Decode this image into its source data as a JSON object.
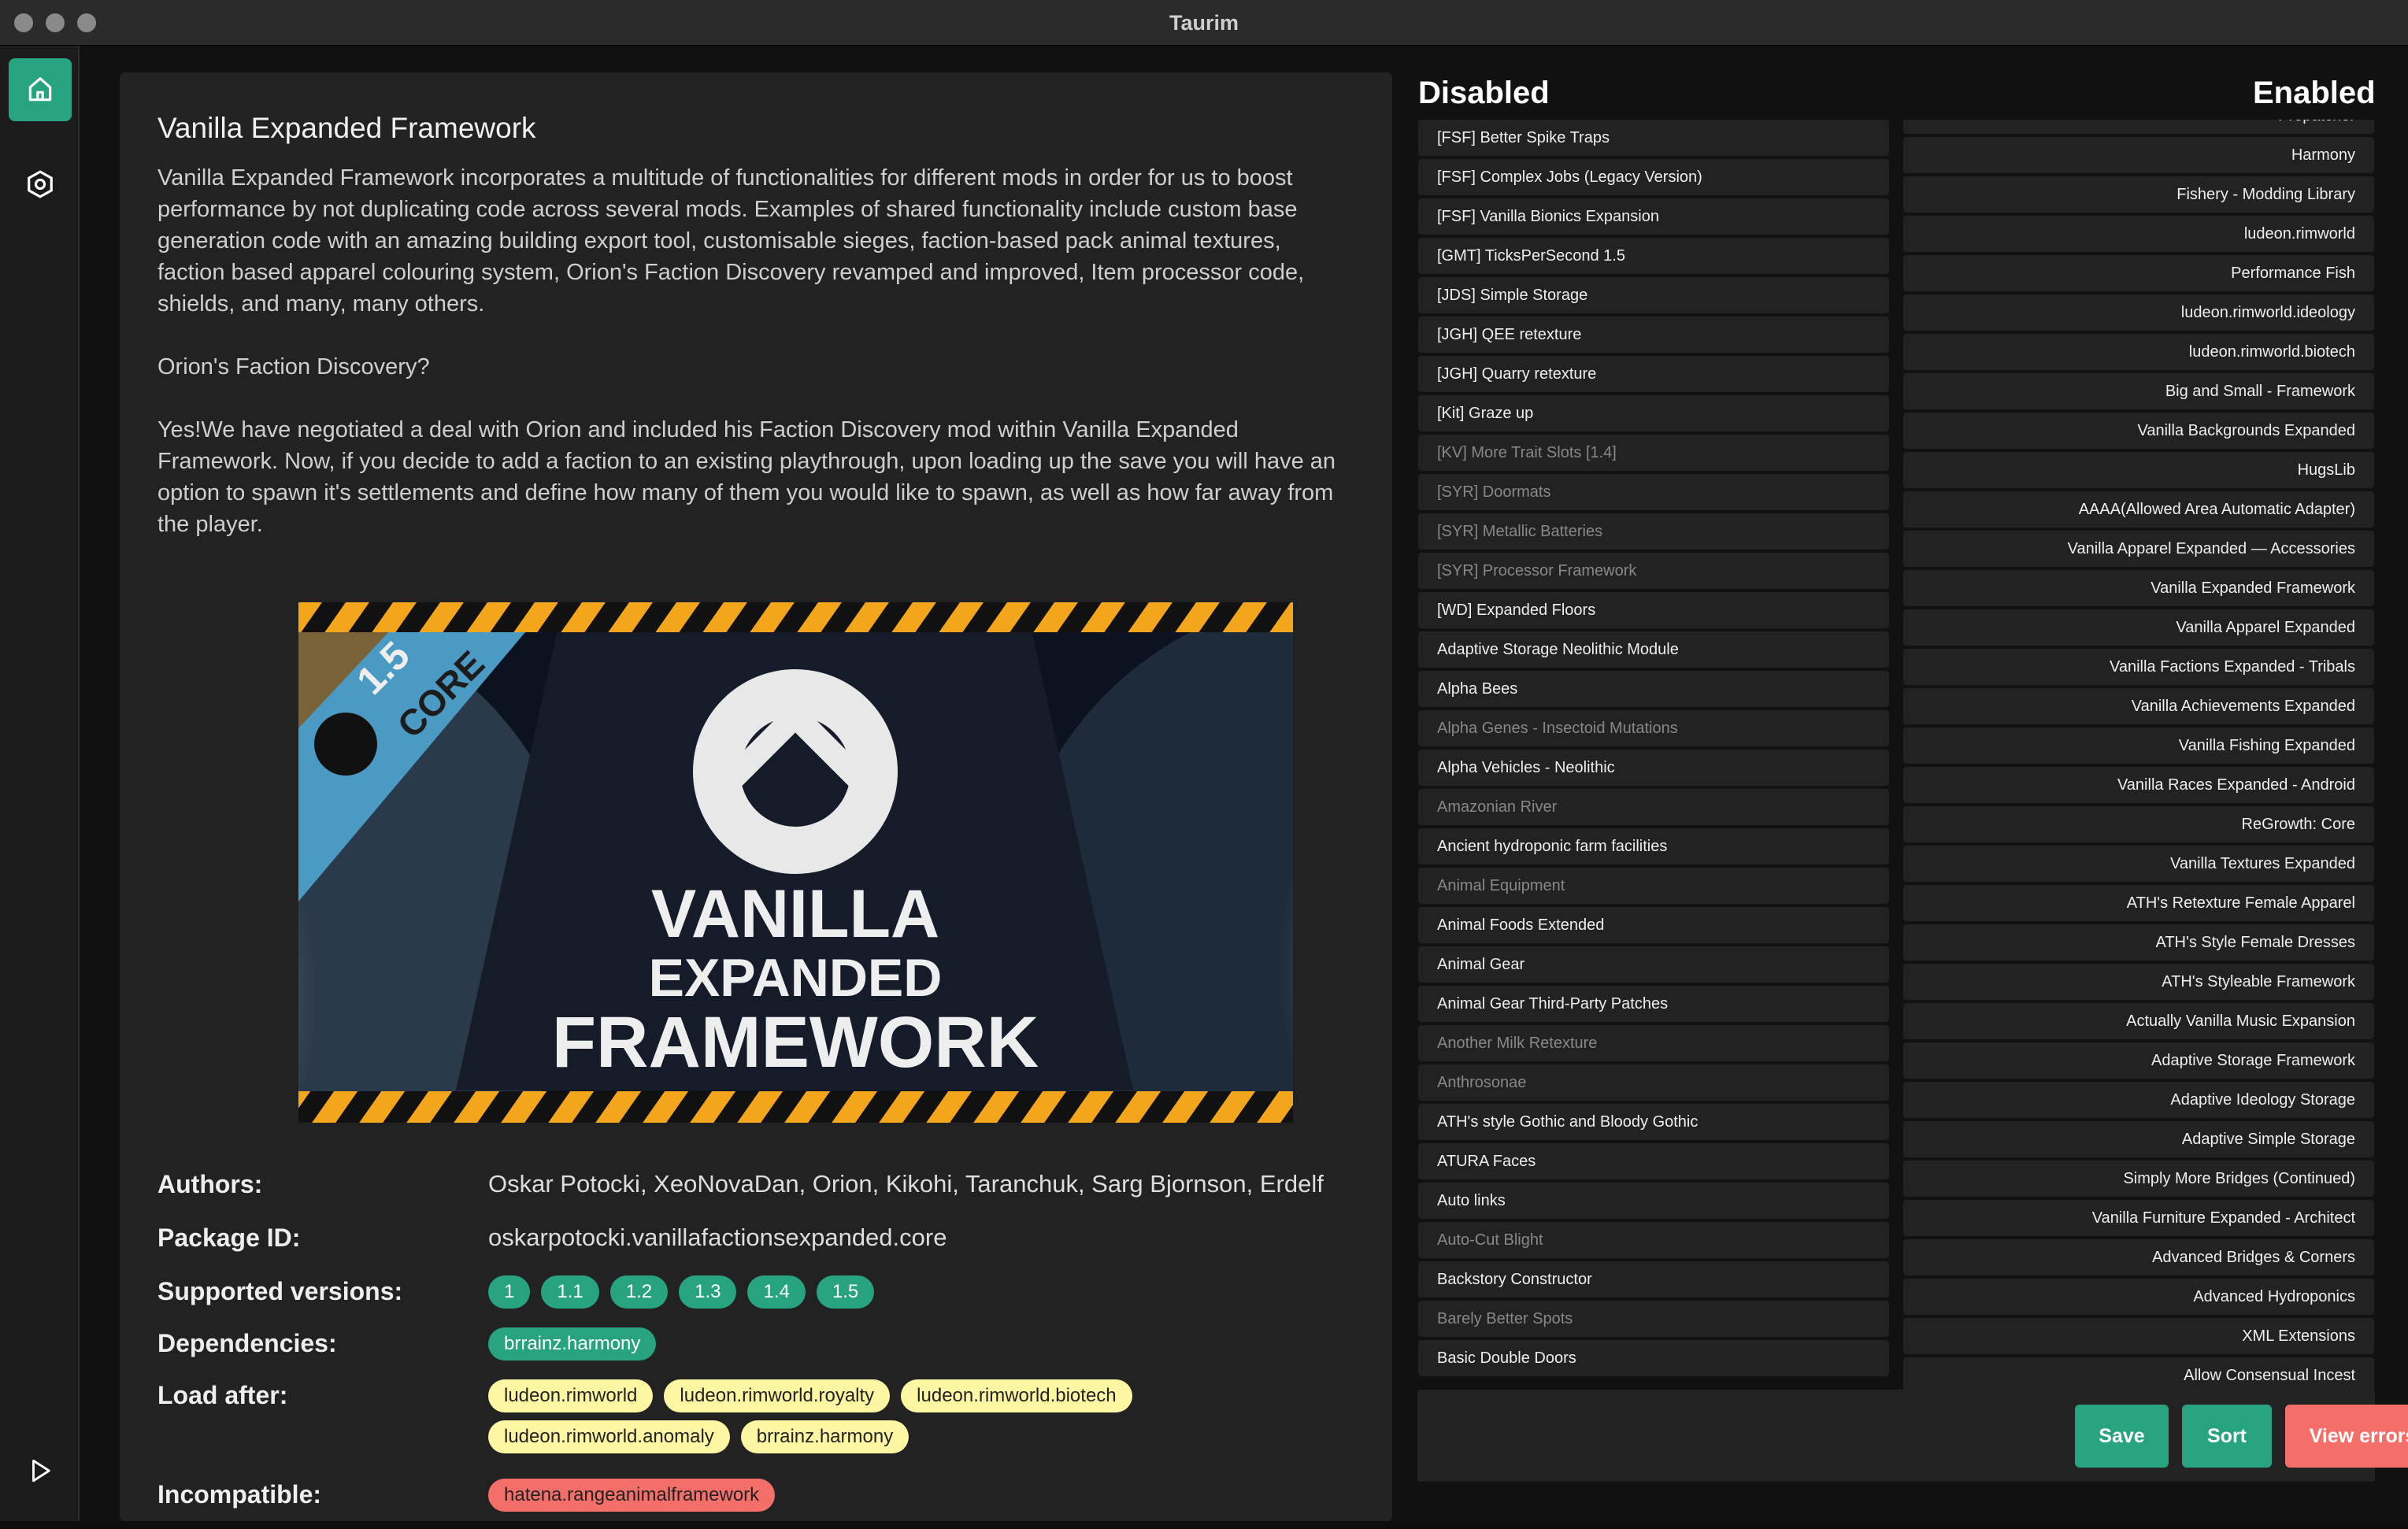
{
  "window": {
    "title": "Taurim"
  },
  "sidebar": {
    "items": [
      {
        "icon": "home-icon"
      },
      {
        "icon": "settings-icon"
      },
      {
        "icon": "play-icon"
      }
    ]
  },
  "mod": {
    "title": "Vanilla Expanded Framework",
    "description": [
      "Vanilla Expanded Framework incorporates a multitude of functionalities for different mods in order for us to boost performance by not duplicating code across several mods. Examples of shared functionality include custom base generation code with an amazing building export tool, customisable sieges, faction-based pack animal textures, faction based apparel colouring system, Orion's Faction Discovery revamped and improved, Item processor code, shields, and many, many others.",
      "Orion's Faction Discovery?",
      "Yes!We have negotiated a deal with Orion and included his Faction Discovery mod within Vanilla Expanded Framework. Now, if you decide to add a faction to an existing playthrough, upon loading up the save you will have an option to spawn it's settlements and define how many of them you would like to spawn, as well as how far away from the player."
    ],
    "banner": {
      "line1": "VANILLA",
      "line2": "EXPANDED",
      "line3": "FRAMEWORK",
      "badge_version": "1.5",
      "badge_text": "CORE"
    },
    "authors_label": "Authors:",
    "authors": "Oskar Potocki, XeoNovaDan, Orion, Kikohi, Taranchuk, Sarg Bjornson, Erdelf",
    "package_label": "Package ID:",
    "package_id": "oskarpotocki.vanillafactionsexpanded.core",
    "versions_label": "Supported versions:",
    "versions": [
      "1",
      "1.1",
      "1.2",
      "1.3",
      "1.4",
      "1.5"
    ],
    "dependencies_label": "Dependencies:",
    "dependencies": [
      "brrainz.harmony"
    ],
    "load_after_label": "Load after:",
    "load_after": [
      "ludeon.rimworld",
      "ludeon.rimworld.royalty",
      "ludeon.rimworld.biotech",
      "ludeon.rimworld.anomaly",
      "brrainz.harmony"
    ],
    "incompatible_label": "Incompatible:",
    "incompatible": [
      "hatena.rangeanimalframework"
    ]
  },
  "disabled": {
    "title": "Disabled",
    "items": [
      {
        "name": "[FSF] Better Spike Traps"
      },
      {
        "name": "[FSF] Complex Jobs (Legacy Version)"
      },
      {
        "name": "[FSF] Vanilla Bionics Expansion"
      },
      {
        "name": "[GMT] TicksPerSecond 1.5"
      },
      {
        "name": "[JDS] Simple Storage"
      },
      {
        "name": "[JGH] QEE retexture"
      },
      {
        "name": "[JGH] Quarry retexture"
      },
      {
        "name": "[Kit] Graze up"
      },
      {
        "name": "[KV] More Trait Slots [1.4]",
        "dim": true
      },
      {
        "name": "[SYR] Doormats",
        "dim": true
      },
      {
        "name": "[SYR] Metallic Batteries",
        "dim": true
      },
      {
        "name": "[SYR] Processor Framework",
        "dim": true
      },
      {
        "name": "[WD] Expanded Floors"
      },
      {
        "name": "Adaptive Storage Neolithic Module"
      },
      {
        "name": "Alpha Bees"
      },
      {
        "name": "Alpha Genes - Insectoid Mutations",
        "dim": true
      },
      {
        "name": "Alpha Vehicles - Neolithic"
      },
      {
        "name": "Amazonian River",
        "dim": true
      },
      {
        "name": "Ancient hydroponic farm facilities"
      },
      {
        "name": "Animal Equipment",
        "dim": true
      },
      {
        "name": "Animal Foods Extended"
      },
      {
        "name": "Animal Gear"
      },
      {
        "name": "Animal Gear Third-Party Patches"
      },
      {
        "name": "Another Milk Retexture",
        "dim": true
      },
      {
        "name": "Anthrosonae",
        "dim": true
      },
      {
        "name": "ATH's style Gothic and Bloody Gothic"
      },
      {
        "name": "ATURA Faces"
      },
      {
        "name": "Auto links"
      },
      {
        "name": "Auto-Cut Blight",
        "dim": true
      },
      {
        "name": "Backstory Constructor"
      },
      {
        "name": "Barely Better Spots",
        "dim": true
      },
      {
        "name": "Basic Double Doors"
      }
    ]
  },
  "enabled": {
    "title": "Enabled",
    "items": [
      "Prepatcher",
      "Harmony",
      "Fishery - Modding Library",
      "ludeon.rimworld",
      "Performance Fish",
      "ludeon.rimworld.ideology",
      "ludeon.rimworld.biotech",
      "Big and Small - Framework",
      "Vanilla Backgrounds Expanded",
      "HugsLib",
      "AAAA(Allowed Area Automatic Adapter)",
      "Vanilla Apparel Expanded — Accessories",
      "Vanilla Expanded Framework",
      "Vanilla Apparel Expanded",
      "Vanilla Factions Expanded - Tribals",
      "Vanilla Achievements Expanded",
      "Vanilla Fishing Expanded",
      "Vanilla Races Expanded - Android",
      "ReGrowth: Core",
      "Vanilla Textures Expanded",
      "ATH's Retexture Female Apparel",
      "ATH's Style Female Dresses",
      "ATH's Styleable Framework",
      "Actually Vanilla Music Expansion",
      "Adaptive Storage Framework",
      "Adaptive Ideology Storage",
      "Adaptive Simple Storage",
      "Simply More Bridges (Continued)",
      "Vanilla Furniture Expanded - Architect",
      "Advanced Bridges & Corners",
      "Advanced Hydroponics",
      "XML Extensions",
      "Allow Consensual Incest"
    ]
  },
  "actions": {
    "save": "Save",
    "sort": "Sort",
    "view_errors": "View errors"
  },
  "colors": {
    "accent": "#27a37f",
    "danger": "#f56f6a",
    "warning": "#fdf6a3"
  }
}
